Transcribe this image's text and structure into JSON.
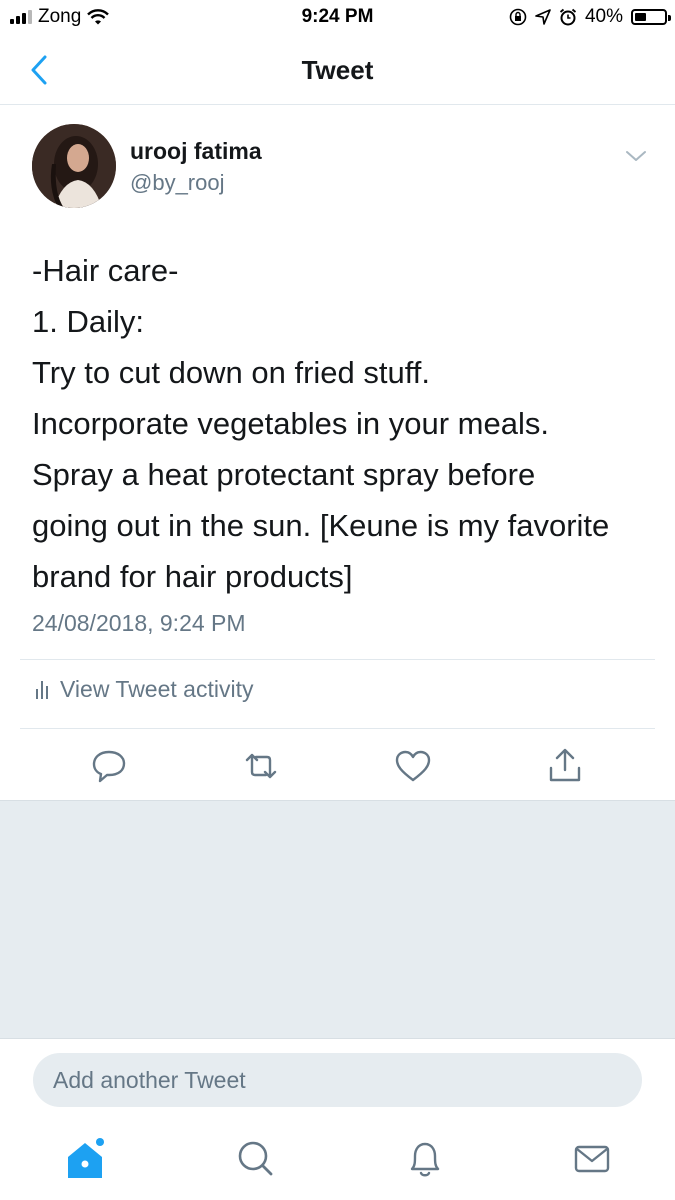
{
  "status_bar": {
    "carrier": "Zong",
    "time": "9:24 PM",
    "battery_percent": "40%",
    "battery_level": 0.4,
    "icons": [
      "signal-icon",
      "wifi-icon",
      "screen-lock-icon",
      "location-icon",
      "alarm-icon",
      "battery-icon"
    ]
  },
  "nav": {
    "back_icon": "chevron-left-icon",
    "title": "Tweet"
  },
  "tweet": {
    "author_name": "urooj fatima",
    "author_handle": "@by_rooj",
    "menu_icon": "chevron-down-icon",
    "lines": [
      "-Hair care-",
      "1. Daily:",
      "Try to cut down on fried stuff.",
      "Incorporate vegetables in your meals.",
      "Spray a heat protectant spray before",
      "going out in the sun. [Keune is my favorite",
      "brand for hair products]"
    ],
    "timestamp": "24/08/2018, 9:24 PM",
    "activity_label": "View Tweet activity"
  },
  "actions": [
    "reply-icon",
    "retweet-icon",
    "like-icon",
    "share-icon"
  ],
  "compose": {
    "placeholder": "Add another Tweet"
  },
  "tab_bar": [
    "home-icon",
    "search-icon",
    "notifications-icon",
    "messages-icon"
  ],
  "colors": {
    "accent": "#1da1f2",
    "secondary_text": "#657786",
    "background_gray": "#e6ecf0"
  }
}
